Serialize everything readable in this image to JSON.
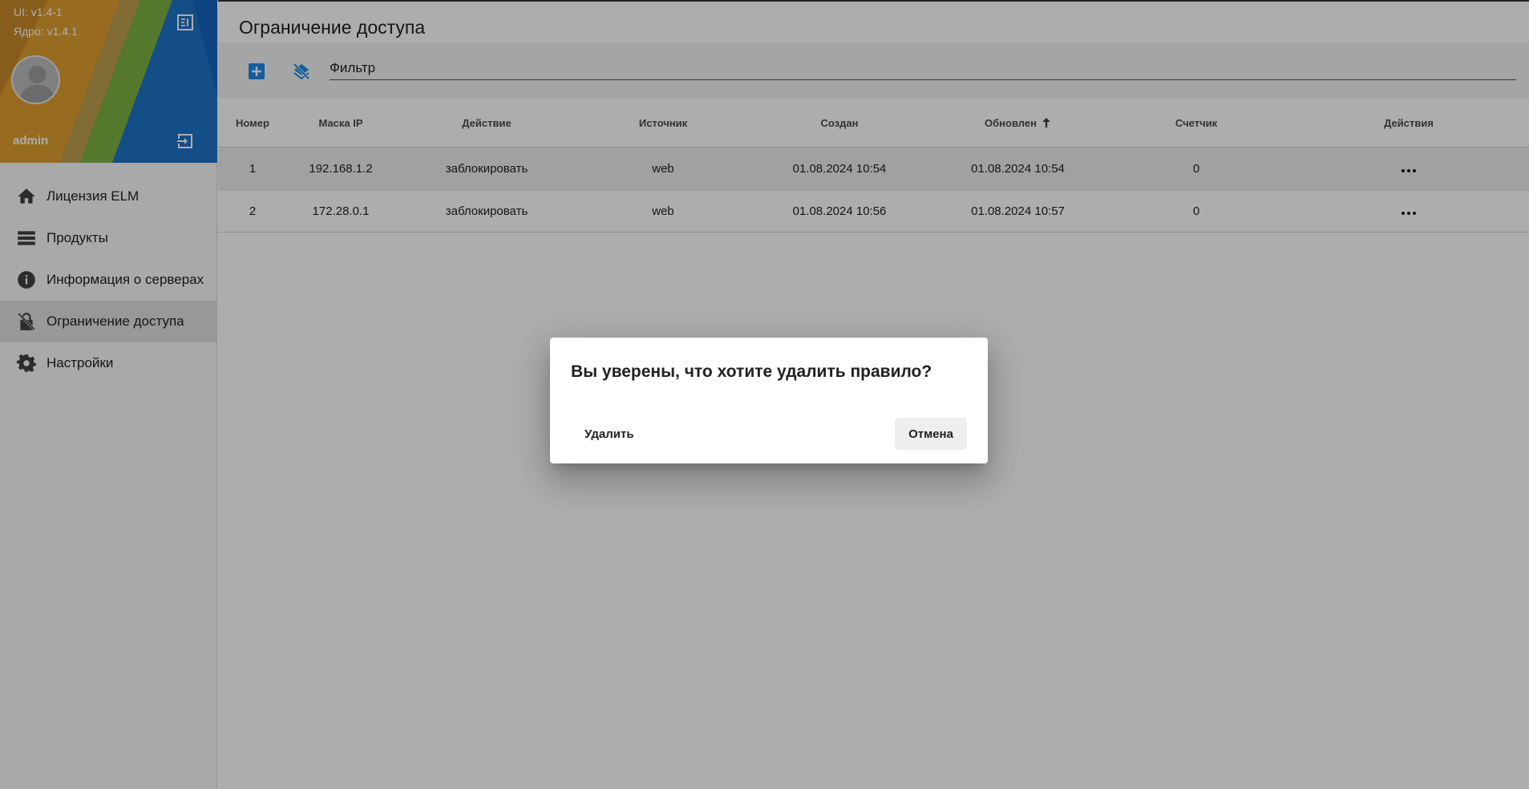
{
  "sidebar": {
    "ui_version": "UI: v1.4-1",
    "core_version": "Ядро: v1.4.1",
    "username": "admin",
    "items": [
      {
        "label": "Лицензия ELM",
        "icon": "home-icon"
      },
      {
        "label": "Продукты",
        "icon": "list-icon"
      },
      {
        "label": "Информация о серверах",
        "icon": "info-icon"
      },
      {
        "label": "Ограничение доступа",
        "icon": "lock-off-icon",
        "active": true
      },
      {
        "label": "Настройки",
        "icon": "gear-icon"
      }
    ]
  },
  "page": {
    "title": "Ограничение доступа",
    "filter_placeholder": "Фильтр"
  },
  "table": {
    "columns": [
      "Номер",
      "Маска IP",
      "Действие",
      "Источник",
      "Создан",
      "Обновлен",
      "Счетчик",
      "Действия"
    ],
    "sorted_column": "Обновлен",
    "rows": [
      {
        "num": "1",
        "mask": "192.168.1.2",
        "action": "заблокировать",
        "source": "web",
        "created": "01.08.2024 10:54",
        "updated": "01.08.2024 10:54",
        "counter": "0"
      },
      {
        "num": "2",
        "mask": "172.28.0.1",
        "action": "заблокировать",
        "source": "web",
        "created": "01.08.2024 10:56",
        "updated": "01.08.2024 10:57",
        "counter": "0"
      }
    ]
  },
  "dialog": {
    "title": "Вы уверены, что хотите удалить правило?",
    "delete_label": "Удалить",
    "cancel_label": "Отмена"
  },
  "colors": {
    "accent": "#1e88e5",
    "overlay": "#000000"
  }
}
